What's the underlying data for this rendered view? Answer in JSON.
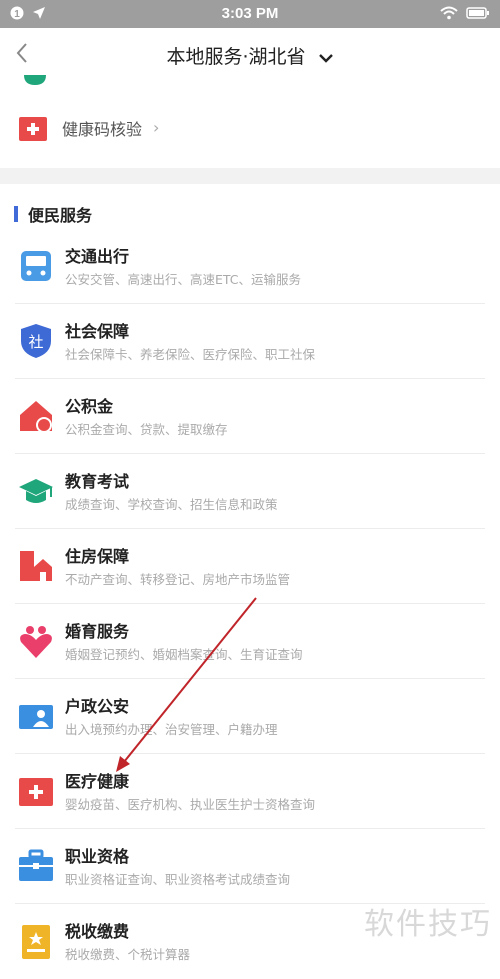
{
  "status_bar": {
    "time": "3:03 PM",
    "left_badge": "1"
  },
  "nav": {
    "title": "本地服务·湖北省"
  },
  "health_code": {
    "label": "健康码核验",
    "arrow": "›"
  },
  "section": {
    "title": "便民服务",
    "items": [
      {
        "name": "交通出行",
        "desc": "公安交管、高速出行、高速ETC、运输服务",
        "icon": "bus-icon",
        "color": "#4a9be6"
      },
      {
        "name": "社会保障",
        "desc": "社会保障卡、养老保险、医疗保险、职工社保",
        "icon": "shield-icon",
        "color": "#3e6ad6"
      },
      {
        "name": "公积金",
        "desc": "公积金查询、贷款、提取缴存",
        "icon": "house-fund-icon",
        "color": "#e84a4a"
      },
      {
        "name": "教育考试",
        "desc": "成绩查询、学校查询、招生信息和政策",
        "icon": "graduation-cap-icon",
        "color": "#1fa67a"
      },
      {
        "name": "住房保障",
        "desc": "不动产查询、转移登记、房地产市场监管",
        "icon": "building-icon",
        "color": "#e84a4a"
      },
      {
        "name": "婚育服务",
        "desc": "婚姻登记预约、婚姻档案查询、生育证查询",
        "icon": "heart-icon",
        "color": "#ea3f6a"
      },
      {
        "name": "户政公安",
        "desc": "出入境预约办理、治安管理、户籍办理",
        "icon": "id-card-icon",
        "color": "#3b8fe0"
      },
      {
        "name": "医疗健康",
        "desc": "婴幼疫苗、医疗机构、执业医生护士资格查询",
        "icon": "medical-cross-icon",
        "color": "#e84a4a"
      },
      {
        "name": "职业资格",
        "desc": "职业资格证查询、职业资格考试成绩查询",
        "icon": "briefcase-icon",
        "color": "#3b8fe0"
      },
      {
        "name": "税收缴费",
        "desc": "税收缴费、个税计算器",
        "icon": "tax-icon",
        "color": "#f0b429"
      }
    ]
  },
  "watermark": "软件技巧",
  "status_bar_right": "wifi-battery"
}
